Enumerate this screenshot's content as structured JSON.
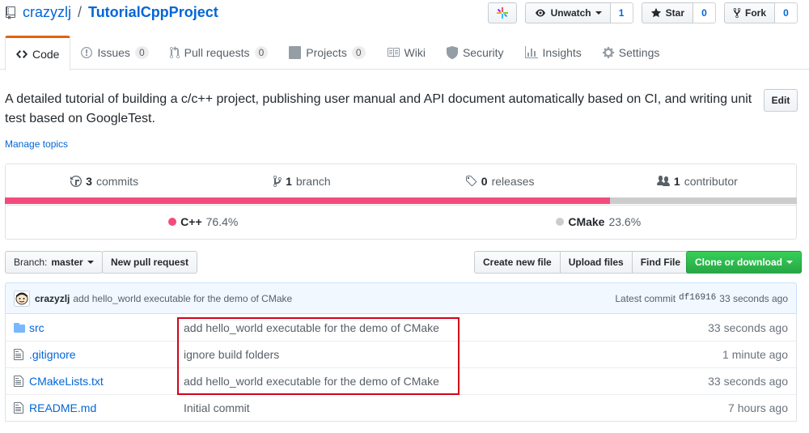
{
  "repo": {
    "owner": "crazyzlj",
    "separator": "/",
    "name": "TutorialCppProject"
  },
  "actions": {
    "watch_label": "Unwatch",
    "watch_count": "1",
    "star_label": "Star",
    "star_count": "0",
    "fork_label": "Fork",
    "fork_count": "0"
  },
  "tabs": [
    {
      "label": "Code",
      "icon": "code-icon",
      "selected": true
    },
    {
      "label": "Issues",
      "count": "0",
      "icon": "issue-icon"
    },
    {
      "label": "Pull requests",
      "count": "0",
      "icon": "pull-request-icon"
    },
    {
      "label": "Projects",
      "count": "0",
      "icon": "project-icon"
    },
    {
      "label": "Wiki",
      "icon": "book-icon"
    },
    {
      "label": "Security",
      "icon": "shield-icon"
    },
    {
      "label": "Insights",
      "icon": "graph-icon"
    },
    {
      "label": "Settings",
      "icon": "gear-icon"
    }
  ],
  "description": "A detailed tutorial of building a c/c++ project, publishing user manual and API document automatically based on CI, and writing unit test based on GoogleTest.",
  "edit_label": "Edit",
  "manage_topics": "Manage topics",
  "summary": {
    "commits_num": "3",
    "commits_label": "commits",
    "branch_num": "1",
    "branch_label": "branch",
    "releases_num": "0",
    "releases_label": "releases",
    "contributors_num": "1",
    "contributors_label": "contributor"
  },
  "languages": [
    {
      "name": "C++",
      "percent": "76.4%",
      "share": 0.764,
      "color": "#f34b7d"
    },
    {
      "name": "CMake",
      "percent": "23.6%",
      "share": 0.236,
      "color": "#cccccc"
    }
  ],
  "file_nav": {
    "branch_prefix": "Branch:",
    "branch_name": "master",
    "new_pr": "New pull request",
    "create_file": "Create new file",
    "upload_files": "Upload files",
    "find_file": "Find File",
    "clone": "Clone or download"
  },
  "latest_commit": {
    "author": "crazyzlj",
    "message": "add hello_world executable for the demo of CMake",
    "label": "Latest commit",
    "sha": "df16916",
    "age": "33 seconds ago"
  },
  "files": [
    {
      "type": "dir",
      "name": "src",
      "message": "add hello_world executable for the demo of CMake",
      "age": "33 seconds ago"
    },
    {
      "type": "file",
      "name": ".gitignore",
      "message": "ignore build folders",
      "age": "1 minute ago"
    },
    {
      "type": "file",
      "name": "CMakeLists.txt",
      "message": "add hello_world executable for the demo of CMake",
      "age": "33 seconds ago"
    },
    {
      "type": "file",
      "name": "README.md",
      "message": "Initial commit",
      "age": "7 hours ago"
    }
  ],
  "colors": {
    "link": "#0366d6",
    "tab_accent": "#e36209",
    "clone_green": "#28a745",
    "highlight_red": "#d0021b"
  }
}
